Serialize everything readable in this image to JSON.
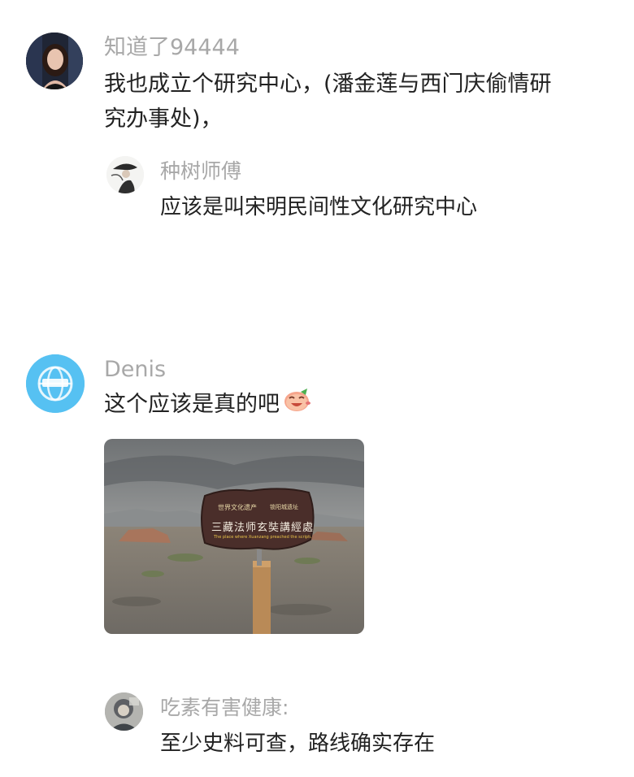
{
  "comments": [
    {
      "user": "知道了94444",
      "text": "我也成立个研究中心，(潘金莲与西门庆偷情研究办事处)，",
      "avatar": "woman-portrait-avatar",
      "replies": [
        {
          "user": "种树师傅",
          "text": "应该是叫宋明民间性文化研究中心",
          "avatar": "ink-figure-avatar"
        }
      ]
    },
    {
      "user": "Denis",
      "text": "这个应该是真的吧",
      "avatar": "blue-globe-avatar",
      "emoji": "laughing-face-emoji",
      "image": {
        "sign_line1_left": "世界文化遗产",
        "sign_line1_right": "锁阳城遗址",
        "sign_title": "三藏法师玄奘講經處",
        "sign_english": "The place where Xuanzang preached the scriptures"
      },
      "replies": [
        {
          "user": "吃素有害健康:",
          "text": "至少史料可查，路线确实存在",
          "avatar": "grey-photo-avatar"
        }
      ]
    }
  ],
  "colors": {
    "username": "#a8a8a8",
    "text": "#222222",
    "avatar_blue": "#56c1f2",
    "sign_brown": "#4a2e2a"
  }
}
